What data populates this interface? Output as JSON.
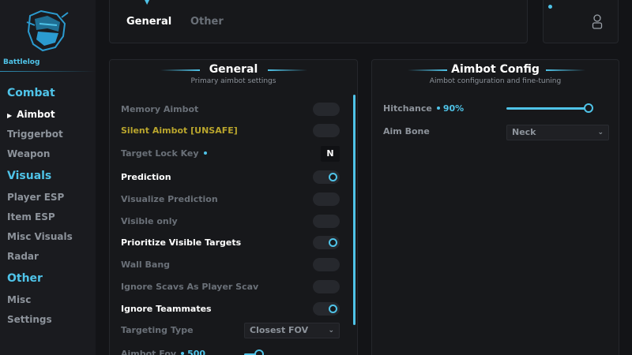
{
  "sidebar": {
    "brand": "Battlelog",
    "sections": [
      {
        "title": "Combat",
        "items": [
          "Aimbot",
          "Triggerbot",
          "Weapon"
        ]
      },
      {
        "title": "Visuals",
        "items": [
          "Player ESP",
          "Item ESP",
          "Misc Visuals",
          "Radar"
        ]
      },
      {
        "title": "Other",
        "items": [
          "Misc",
          "Settings"
        ]
      }
    ],
    "active_item": "Aimbot"
  },
  "tabs": {
    "general": "General",
    "other": "Other"
  },
  "left_panel": {
    "title": "General",
    "subtitle": "Primary aimbot settings",
    "rows": [
      {
        "label": "Memory Aimbot",
        "state": false
      },
      {
        "label": "Silent Aimbot [UNSAFE]",
        "state": false
      },
      {
        "label": "Target Lock Key",
        "key": "N"
      },
      {
        "label": "Prediction",
        "state": true
      },
      {
        "label": "Visualize Prediction",
        "state": false
      },
      {
        "label": "Visible only",
        "state": false
      },
      {
        "label": "Prioritize Visible Targets",
        "state": true
      },
      {
        "label": "Wall Bang",
        "state": false
      },
      {
        "label": "Ignore Scavs As Player Scav",
        "state": false
      },
      {
        "label": "Ignore Teammates",
        "state": true
      },
      {
        "label": "Targeting Type",
        "select": "Closest FOV"
      },
      {
        "label": "Aimbot Fov",
        "value": "500",
        "fill_fraction": 0.16
      }
    ]
  },
  "right_panel": {
    "title": "Aimbot Config",
    "subtitle": "Aimbot configuration and fine-tuning",
    "hitchance": {
      "label": "Hitchance",
      "value": "90%",
      "fill_fraction": 0.9
    },
    "aim_bone": {
      "label": "Aim Bone",
      "value": "Neck"
    }
  },
  "colors": {
    "accent": "#4fc3e8",
    "warn": "#b9a52d",
    "background": "#131417"
  }
}
